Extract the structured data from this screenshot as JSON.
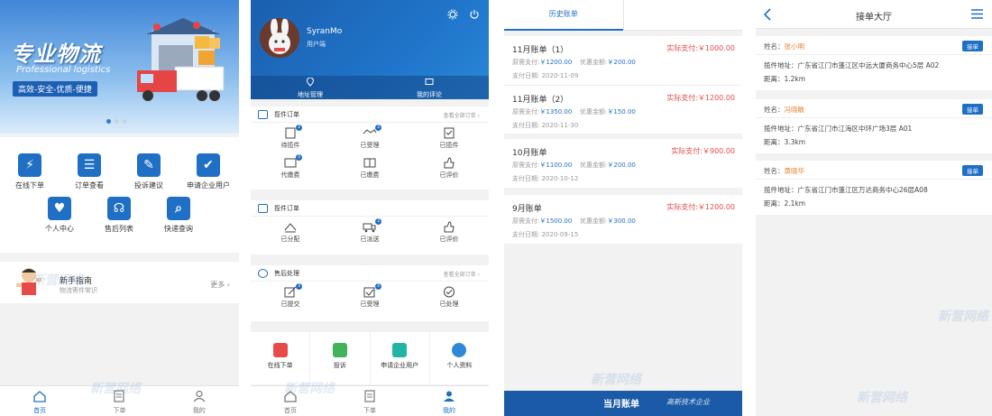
{
  "screen1": {
    "hero_title": "专业物流",
    "hero_subtitle": "Professional logistics",
    "hero_slogan": "高效-安全-优质-便捷",
    "grid": [
      {
        "label": "在线下单",
        "glyph": "⚡",
        "icon": "order-lightning-icon"
      },
      {
        "label": "订单查看",
        "glyph": "☰",
        "icon": "clipboard-icon"
      },
      {
        "label": "投诉建议",
        "glyph": "✎",
        "icon": "document-edit-icon"
      },
      {
        "label": "申请企业用户",
        "glyph": "✔",
        "icon": "checkbox-icon"
      },
      {
        "label": "个人中心",
        "glyph": "♥",
        "icon": "heart-shield-icon"
      },
      {
        "label": "售后列表",
        "glyph": "☊",
        "icon": "headset-icon"
      },
      {
        "label": "快递查询",
        "glyph": "⌕",
        "icon": "search-icon"
      }
    ],
    "guide_title": "新手指南",
    "guide_subtitle": "物流寄件常识",
    "guide_more": "更多",
    "tabs": [
      {
        "label": "首页",
        "icon": "home-icon",
        "active": true
      },
      {
        "label": "下单",
        "icon": "order-list-icon",
        "active": false
      },
      {
        "label": "我的",
        "icon": "user-icon",
        "active": false
      }
    ]
  },
  "screen2": {
    "username": "SyranMo",
    "role": "用户端",
    "nav": [
      {
        "label": "地址管理",
        "icon": "location-pin-icon"
      },
      {
        "label": "我的评论",
        "icon": "comment-icon"
      }
    ],
    "sections": [
      {
        "title": "揽件订单",
        "more": "查看全部订单",
        "icon": "list-icon",
        "items": [
          {
            "label": "待揽件",
            "badge": "3"
          },
          {
            "label": "已受理",
            "badge": "3"
          },
          {
            "label": "已揽件",
            "badge": ""
          },
          {
            "label": "代缴费",
            "badge": "3"
          },
          {
            "label": "已缴费",
            "badge": ""
          },
          {
            "label": "已评价",
            "badge": ""
          }
        ]
      },
      {
        "title": "揽件订单",
        "more": "",
        "icon": "list-icon",
        "items": [
          {
            "label": "已分配",
            "badge": ""
          },
          {
            "label": "已派送",
            "badge": "3"
          },
          {
            "label": "已评价",
            "badge": ""
          }
        ]
      },
      {
        "title": "售后处理",
        "more": "查看全部订单",
        "icon": "chat-icon",
        "items": [
          {
            "label": "已提交",
            "badge": "3"
          },
          {
            "label": "已受理",
            "badge": "3"
          },
          {
            "label": "已处理",
            "badge": ""
          }
        ]
      }
    ],
    "quick": [
      {
        "label": "在线下单",
        "color": "#e84a4a",
        "icon": "order-edit-icon"
      },
      {
        "label": "投诉",
        "color": "#43b35a",
        "icon": "complaint-icon"
      },
      {
        "label": "申请企业用户",
        "color": "#22b5a6",
        "icon": "enterprise-check-icon"
      },
      {
        "label": "个人资料",
        "color": "#2e8ad6",
        "icon": "profile-icon"
      }
    ],
    "tabs": [
      {
        "label": "首页",
        "icon": "home-icon",
        "active": false
      },
      {
        "label": "下单",
        "icon": "order-list-icon",
        "active": false
      },
      {
        "label": "我的",
        "icon": "user-icon",
        "active": true
      }
    ]
  },
  "screen3": {
    "tabs": [
      "历史账单",
      ""
    ],
    "orig_label": "原需支付:",
    "disc_label": "优惠金额:",
    "date_label": "支付日期:",
    "bills": [
      {
        "title": "11月账单（1）",
        "actual": "实际支付:￥1000.00",
        "orig": "￥1200.00",
        "disc": "￥200.00",
        "date": "2020-11-09"
      },
      {
        "title": "11月账单（2）",
        "actual": "实际支付:￥1200.00",
        "orig": "￥1350.00",
        "disc": "￥150.00",
        "date": "2020-11-30"
      },
      {
        "title": "10月账单",
        "actual": "实际支付:￥900.00",
        "orig": "￥1100.00",
        "disc": "￥200.00",
        "date": "2020-10-12"
      },
      {
        "title": "9月账单",
        "actual": "实际支付:￥1200.00",
        "orig": "￥1500.00",
        "disc": "￥300.00",
        "date": "2020-09-15"
      }
    ],
    "footer_brand": "当月账单",
    "footer_slogan": "高新技术企业"
  },
  "screen4": {
    "title": "接单大厅",
    "name_label": "姓名：",
    "accept_label": "接单",
    "orders": [
      {
        "name": "张小明",
        "address": "揽件地址：广东省江门市蓬江区中远大厦商务中心5层 A02",
        "distance": "距离：1.2km"
      },
      {
        "name": "冯晓敏",
        "address": "揽件地址：广东省江门市江海区中环广场3层 A01",
        "distance": "距离：3.3km"
      },
      {
        "name": "黄晓华",
        "address": "揽件地址：广东省江门市蓬江区万达商务中心26层A08",
        "distance": "距离：2.1km"
      }
    ]
  },
  "watermark": "新营网络",
  "colors": {
    "primary": "#1f6fc4",
    "danger": "#e84a4a",
    "accent": "#e8822f",
    "bg": "#f2f2f2"
  }
}
